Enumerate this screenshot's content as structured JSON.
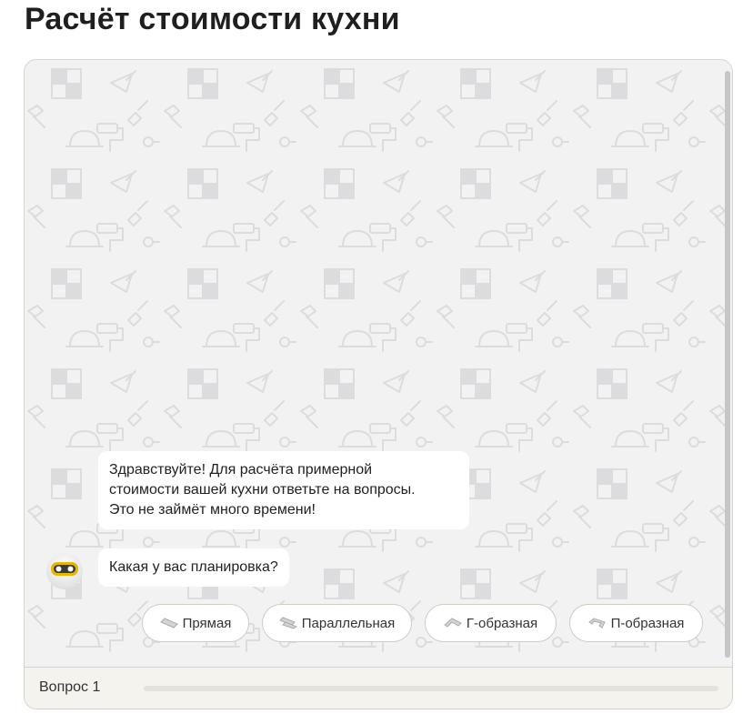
{
  "page": {
    "title": "Расчёт стоимости кухни"
  },
  "chat": {
    "messages": [
      {
        "lines": [
          "Здравствуйте! Для расчёта примерной",
          "стоимости вашей кухни ответьте на вопросы.",
          "Это не займёт много времени!"
        ]
      },
      {
        "lines": [
          "Какая у вас планировка?"
        ]
      }
    ],
    "options": [
      {
        "label": "Прямая",
        "icon": "straight-layout-icon"
      },
      {
        "label": "Параллельная",
        "icon": "parallel-layout-icon"
      },
      {
        "label": "Г-образная",
        "icon": "l-shaped-layout-icon"
      },
      {
        "label": "П-образная",
        "icon": "u-shaped-layout-icon"
      }
    ],
    "avatar_icon": "robot-avatar-icon",
    "background_icons": [
      "tile-icon",
      "drill-icon",
      "saw-icon",
      "trowel-icon",
      "hardhat-icon",
      "hammer-icon",
      "brush-icon",
      "paint-roller-icon",
      "tape-measure-icon",
      "paint-bucket-icon",
      "wallpaper-roll-icon"
    ]
  },
  "footer": {
    "question_label": "Вопрос 1",
    "progress": 0
  },
  "colors": {
    "chat_background": "#f2f2f3",
    "bubble": "#ffffff",
    "border": "#d6d3c8",
    "footer_background": "#f4f3ee",
    "avatar_accent": "#e6b800"
  }
}
